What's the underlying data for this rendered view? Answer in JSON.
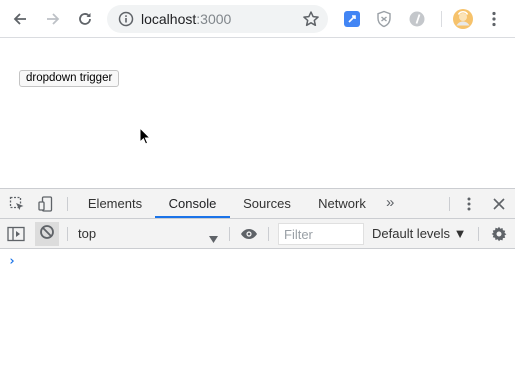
{
  "browser": {
    "url_host": "localhost",
    "url_port": ":3000",
    "icons": {
      "back": "arrow-left-icon",
      "forward": "arrow-right-icon",
      "reload": "reload-icon",
      "site_info": "info-icon",
      "bookmark": "star-icon",
      "ext1": "extension-blue-icon",
      "ext2": "shield-extension-icon",
      "ext3": "extension-gray-icon",
      "profile": "avatar-icon",
      "menu": "kebab-menu-icon"
    }
  },
  "page": {
    "trigger_label": "dropdown trigger"
  },
  "devtools": {
    "tabs": [
      {
        "label": "Elements",
        "active": false
      },
      {
        "label": "Console",
        "active": true
      },
      {
        "label": "Sources",
        "active": false
      },
      {
        "label": "Network",
        "active": false
      }
    ],
    "more_tabs": "»",
    "context": "top",
    "filter_placeholder": "Filter",
    "levels_label": "Default levels ▼",
    "prompt": "›",
    "colors": {
      "accent": "#1a73e8",
      "toolbar_bg": "#f3f3f3"
    }
  }
}
